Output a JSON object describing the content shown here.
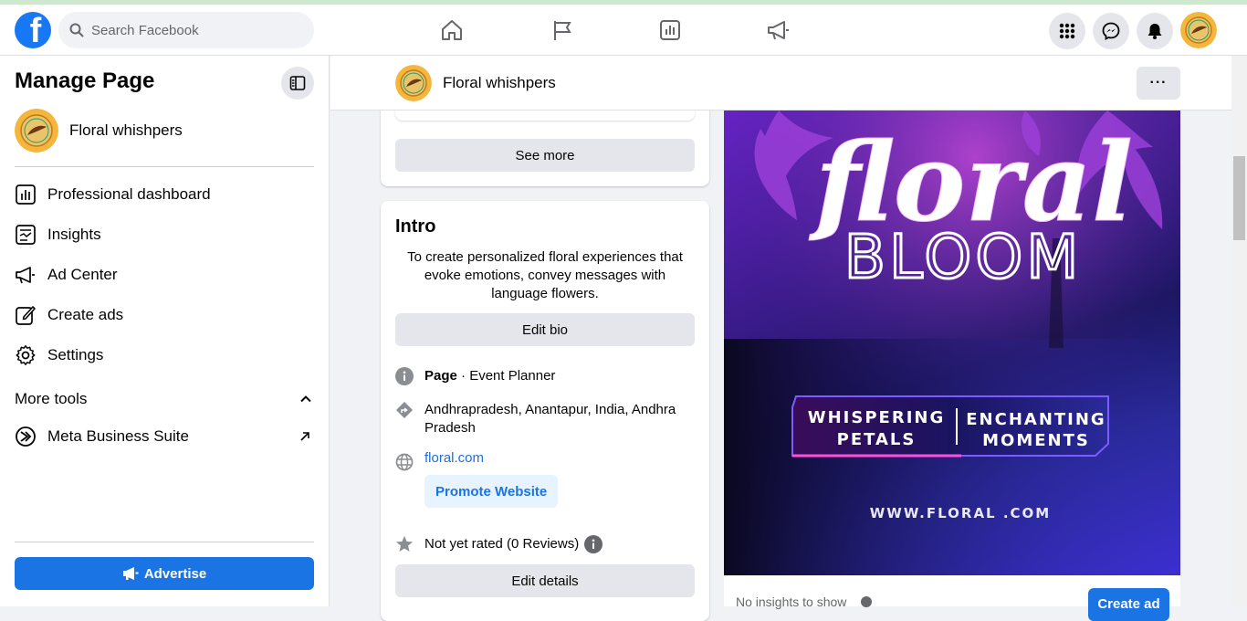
{
  "search": {
    "placeholder": "Search Facebook"
  },
  "sidebar": {
    "title": "Manage Page",
    "page_name": "Floral whishpers",
    "items": [
      {
        "label": "Professional dashboard",
        "icon": "dashboard-icon"
      },
      {
        "label": "Insights",
        "icon": "insights-icon"
      },
      {
        "label": "Ad Center",
        "icon": "megaphone-icon"
      },
      {
        "label": "Create ads",
        "icon": "pencil-icon"
      },
      {
        "label": "Settings",
        "icon": "gear-icon"
      }
    ],
    "more_tools": "More tools",
    "meta_business_suite": "Meta Business Suite",
    "advertise": "Advertise"
  },
  "header": {
    "page_name": "Floral whishpers",
    "more": "···"
  },
  "content": {
    "see_more": "See more",
    "intro": {
      "title": "Intro",
      "bio": "To create personalized floral experiences that evoke emotions, convey messages with language flowers.",
      "edit_bio": "Edit bio",
      "category_bold": "Page",
      "category_rest": " · Event Planner",
      "location": "Andhrapradesh, Anantapur, India, Andhra Pradesh",
      "website": "floral.com",
      "promote_website": "Promote Website",
      "rating": "Not yet rated (0 Reviews)",
      "edit_details": "Edit details"
    },
    "cover": {
      "script_text": "floral",
      "bloom": "BLOOM",
      "left_banner_line1": "WHISPERING",
      "left_banner_line2": "PETALS",
      "right_banner_line1": "ENCHANTING",
      "right_banner_line2": "MOMENTS",
      "url": "WWW.FLORAL .COM"
    },
    "no_insights": "No insights to show",
    "create_ad": "Create ad"
  },
  "colors": {
    "brand": "#1877f2",
    "advertise": "#1b74e4",
    "link": "#216fdb"
  }
}
